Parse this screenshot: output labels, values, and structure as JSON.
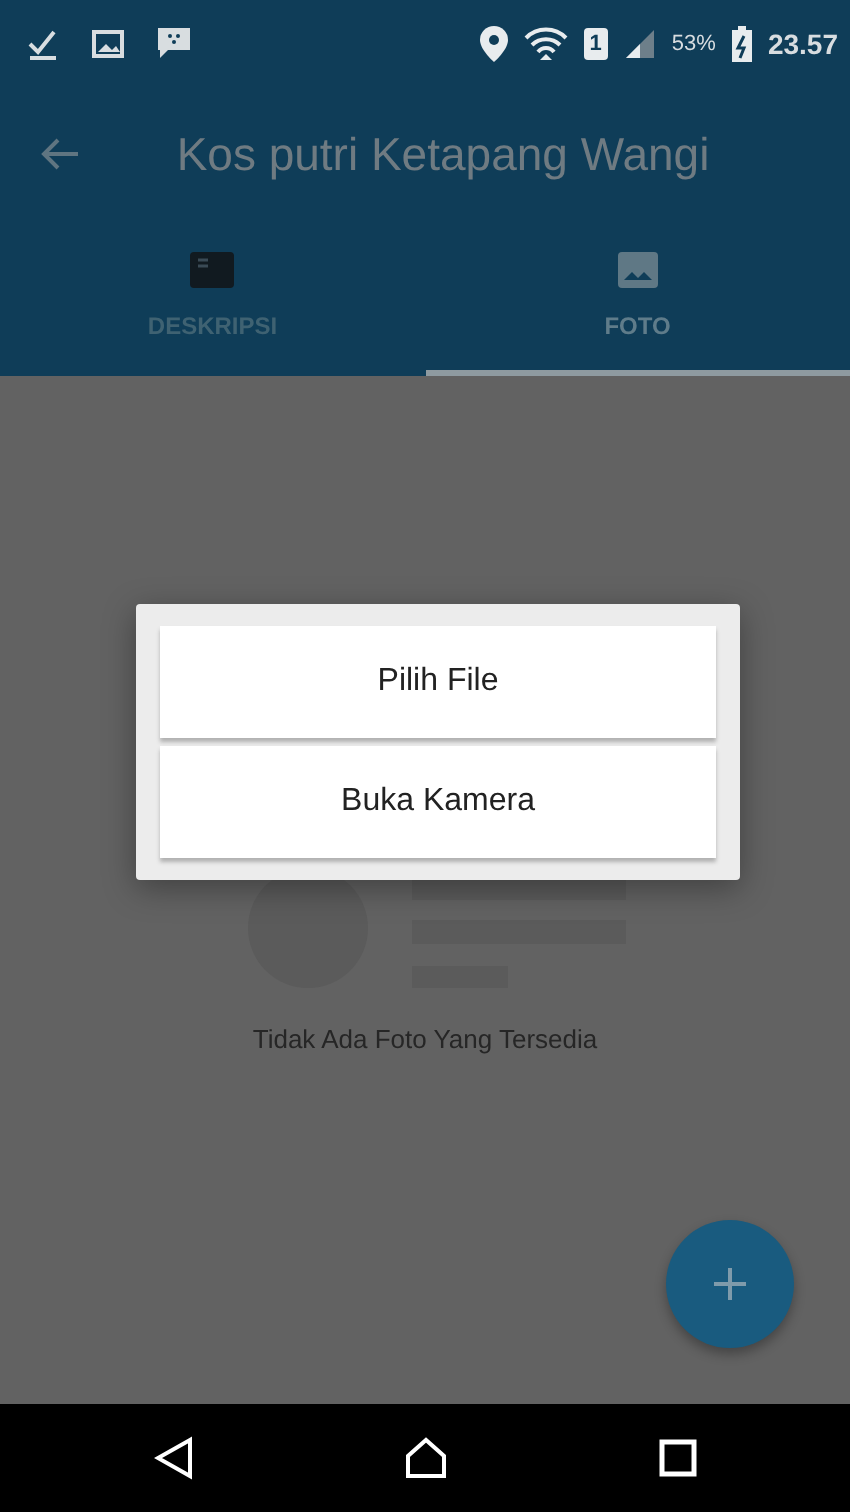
{
  "status_bar": {
    "sim_slot": "1",
    "battery": "53%",
    "time": "23.57"
  },
  "app_bar": {
    "title": "Kos putri Ketapang Wangi"
  },
  "tabs": [
    {
      "label": "DESKRIPSI",
      "kind": "card",
      "selected": false
    },
    {
      "label": "FOTO",
      "kind": "image",
      "selected": true
    }
  ],
  "empty_state": {
    "message": "Tidak Ada Foto Yang Tersedia"
  },
  "dialog": {
    "options": [
      "Pilih File",
      "Buka Kamera"
    ]
  }
}
